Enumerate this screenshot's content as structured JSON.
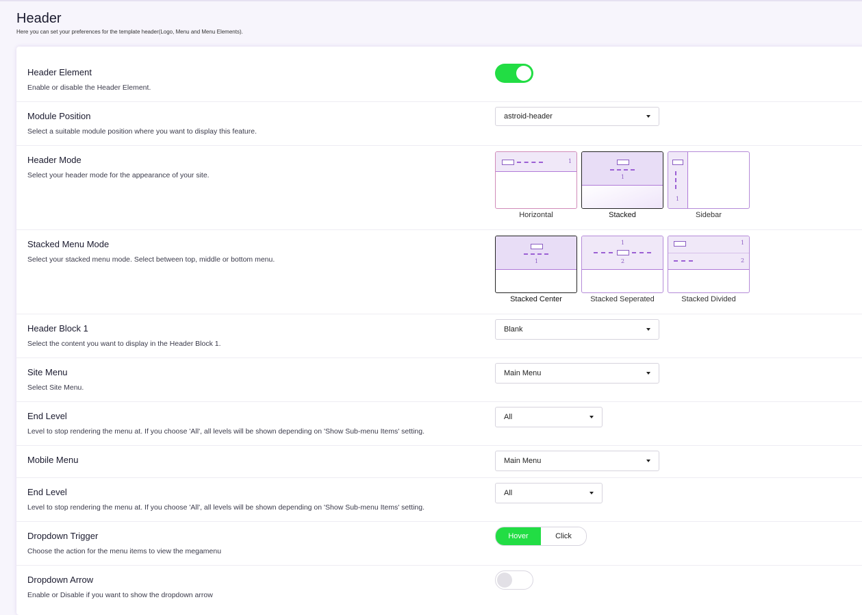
{
  "page": {
    "title": "Header",
    "subtitle": "Here you can set your preferences for the template header(Logo, Menu and Menu Elements)."
  },
  "colors": {
    "accent": "#22dd44",
    "purple": "#9b5fd4"
  },
  "fields": {
    "header_element": {
      "label": "Header Element",
      "desc": "Enable or disable the Header Element.",
      "enabled": true
    },
    "module_position": {
      "label": "Module Position",
      "desc": "Select a suitable module position where you want to display this feature.",
      "value": "astroid-header"
    },
    "header_mode": {
      "label": "Header Mode",
      "desc": "Select your header mode for the appearance of your site.",
      "options": [
        "Horizontal",
        "Stacked",
        "Sidebar"
      ],
      "selected": "Stacked"
    },
    "stacked_menu_mode": {
      "label": "Stacked Menu Mode",
      "desc": "Select your stacked menu mode. Select between top, middle or bottom menu.",
      "options": [
        "Stacked Center",
        "Stacked Seperated",
        "Stacked Divided"
      ],
      "selected": "Stacked Center"
    },
    "header_block_1": {
      "label": "Header Block 1",
      "desc": "Select the content you want to display in the Header Block 1.",
      "value": "Blank"
    },
    "site_menu": {
      "label": "Site Menu",
      "desc": "Select Site Menu.",
      "value": "Main Menu"
    },
    "end_level_1": {
      "label": "End Level",
      "desc": "Level to stop rendering the menu at. If you choose 'All', all levels will be shown depending on 'Show Sub-menu Items' setting.",
      "value": "All"
    },
    "mobile_menu": {
      "label": "Mobile Menu",
      "value": "Main Menu"
    },
    "end_level_2": {
      "label": "End Level",
      "desc": "Level to stop rendering the menu at. If you choose 'All', all levels will be shown depending on 'Show Sub-menu Items' setting.",
      "value": "All"
    },
    "dropdown_trigger": {
      "label": "Dropdown Trigger",
      "desc": "Choose the action for the menu items to view the megamenu",
      "options": [
        "Hover",
        "Click"
      ],
      "selected": "Hover"
    },
    "dropdown_arrow": {
      "label": "Dropdown Arrow",
      "desc": "Enable or Disable if you want to show the dropdown arrow",
      "enabled": false
    }
  },
  "preview_numbers": {
    "one": "1",
    "two": "2"
  },
  "icons": {
    "select_caret": "caret-down-icon"
  }
}
